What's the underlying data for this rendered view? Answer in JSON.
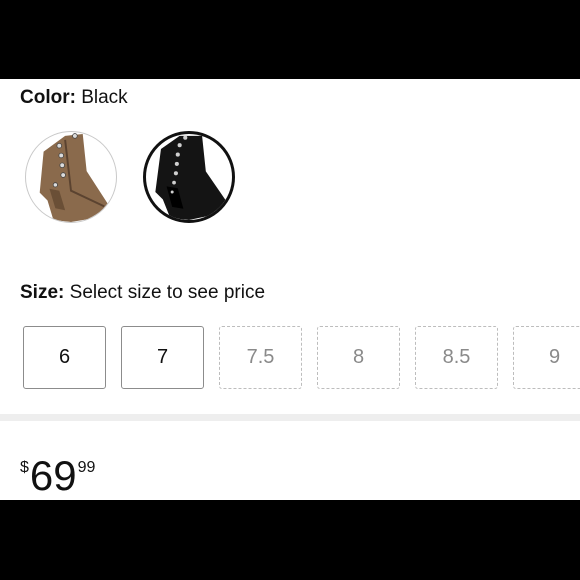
{
  "color_selector": {
    "label": "Color:",
    "selected_value": "Black",
    "swatches": [
      {
        "name": "brown-boot",
        "selected": false,
        "color": "#8a6a4c"
      },
      {
        "name": "black-boot",
        "selected": true,
        "color": "#141414"
      }
    ]
  },
  "size_selector": {
    "label": "Size:",
    "hint": "Select size to see price",
    "options": [
      {
        "label": "6",
        "available": true
      },
      {
        "label": "7",
        "available": true
      },
      {
        "label": "7.5",
        "available": false
      },
      {
        "label": "8",
        "available": false
      },
      {
        "label": "8.5",
        "available": false
      },
      {
        "label": "9",
        "available": false
      }
    ]
  },
  "price": {
    "currency_symbol": "$",
    "whole": "69",
    "fraction": "99"
  }
}
